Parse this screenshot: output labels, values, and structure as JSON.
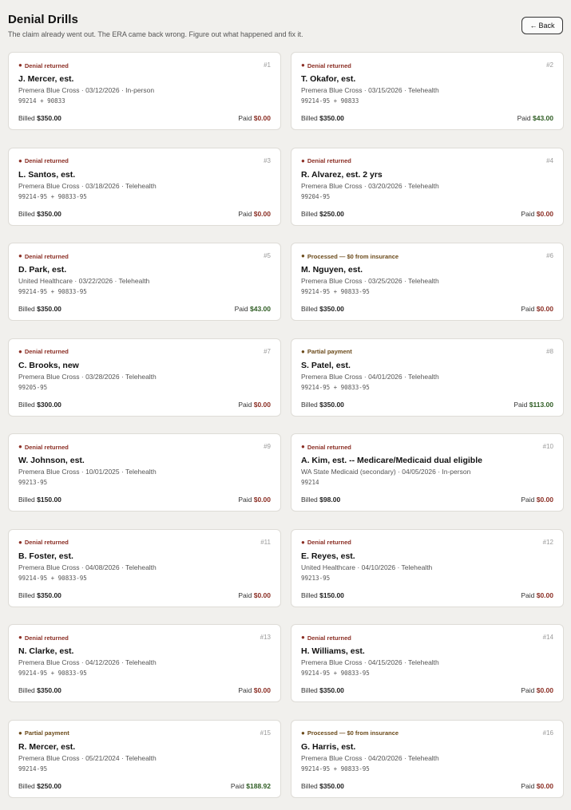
{
  "header": {
    "title": "Denial Drills",
    "subtitle": "The claim already went out. The ERA came back wrong. Figure out what happened and fix it.",
    "back_label": "Back",
    "back_arrow": "←"
  },
  "labels": {
    "billed": "Billed",
    "paid": "Paid"
  },
  "colors": {
    "denied": "#8b2e24",
    "paid_positive": "#2f5d24",
    "background": "#f1f0ed"
  },
  "cards": [
    {
      "status": "Denial returned",
      "status_type": "denied",
      "num": "#1",
      "name": "J. Mercer, est.",
      "meta": "Premera Blue Cross · 03/12/2026 · In-person",
      "codes": "99214 + 90833",
      "billed": "$350.00",
      "paid": "$0.00",
      "paid_positive": false
    },
    {
      "status": "Denial returned",
      "status_type": "denied",
      "num": "#2",
      "name": "T. Okafor, est.",
      "meta": "Premera Blue Cross · 03/15/2026 · Telehealth",
      "codes": "99214-95 + 90833",
      "billed": "$350.00",
      "paid": "$43.00",
      "paid_positive": true
    },
    {
      "status": "Denial returned",
      "status_type": "denied",
      "num": "#3",
      "name": "L. Santos, est.",
      "meta": "Premera Blue Cross · 03/18/2026 · Telehealth",
      "codes": "99214-95 + 90833-95",
      "billed": "$350.00",
      "paid": "$0.00",
      "paid_positive": false
    },
    {
      "status": "Denial returned",
      "status_type": "denied",
      "num": "#4",
      "name": "R. Alvarez, est. 2 yrs",
      "meta": "Premera Blue Cross · 03/20/2026 · Telehealth",
      "codes": "99204-95",
      "billed": "$250.00",
      "paid": "$0.00",
      "paid_positive": false
    },
    {
      "status": "Denial returned",
      "status_type": "denied",
      "num": "#5",
      "name": "D. Park, est.",
      "meta": "United Healthcare · 03/22/2026 · Telehealth",
      "codes": "99214-95 + 90833-95",
      "billed": "$350.00",
      "paid": "$43.00",
      "paid_positive": true
    },
    {
      "status": "Processed — $0 from insurance",
      "status_type": "processed",
      "num": "#6",
      "name": "M. Nguyen, est.",
      "meta": "Premera Blue Cross · 03/25/2026 · Telehealth",
      "codes": "99214-95 + 90833-95",
      "billed": "$350.00",
      "paid": "$0.00",
      "paid_positive": false
    },
    {
      "status": "Denial returned",
      "status_type": "denied",
      "num": "#7",
      "name": "C. Brooks, new",
      "meta": "Premera Blue Cross · 03/28/2026 · Telehealth",
      "codes": "99205-95",
      "billed": "$300.00",
      "paid": "$0.00",
      "paid_positive": false
    },
    {
      "status": "Partial payment",
      "status_type": "partial",
      "num": "#8",
      "name": "S. Patel, est.",
      "meta": "Premera Blue Cross · 04/01/2026 · Telehealth",
      "codes": "99214-95 + 90833-95",
      "billed": "$350.00",
      "paid": "$113.00",
      "paid_positive": true
    },
    {
      "status": "Denial returned",
      "status_type": "denied",
      "num": "#9",
      "name": "W. Johnson, est.",
      "meta": "Premera Blue Cross · 10/01/2025 · Telehealth",
      "codes": "99213-95",
      "billed": "$150.00",
      "paid": "$0.00",
      "paid_positive": false
    },
    {
      "status": "Denial returned",
      "status_type": "denied",
      "num": "#10",
      "name": "A. Kim, est. -- Medicare/Medicaid dual eligible",
      "meta": "WA State Medicaid (secondary) · 04/05/2026 · In-person",
      "codes": "99214",
      "billed": "$98.00",
      "paid": "$0.00",
      "paid_positive": false
    },
    {
      "status": "Denial returned",
      "status_type": "denied",
      "num": "#11",
      "name": "B. Foster, est.",
      "meta": "Premera Blue Cross · 04/08/2026 · Telehealth",
      "codes": "99214-95 + 90833-95",
      "billed": "$350.00",
      "paid": "$0.00",
      "paid_positive": false
    },
    {
      "status": "Denial returned",
      "status_type": "denied",
      "num": "#12",
      "name": "E. Reyes, est.",
      "meta": "United Healthcare · 04/10/2026 · Telehealth",
      "codes": "99213-95",
      "billed": "$150.00",
      "paid": "$0.00",
      "paid_positive": false
    },
    {
      "status": "Denial returned",
      "status_type": "denied",
      "num": "#13",
      "name": "N. Clarke, est.",
      "meta": "Premera Blue Cross · 04/12/2026 · Telehealth",
      "codes": "99214-95 + 90833-95",
      "billed": "$350.00",
      "paid": "$0.00",
      "paid_positive": false
    },
    {
      "status": "Denial returned",
      "status_type": "denied",
      "num": "#14",
      "name": "H. Williams, est.",
      "meta": "Premera Blue Cross · 04/15/2026 · Telehealth",
      "codes": "99214-95 + 90833-95",
      "billed": "$350.00",
      "paid": "$0.00",
      "paid_positive": false
    },
    {
      "status": "Partial payment",
      "status_type": "partial",
      "num": "#15",
      "name": "R. Mercer, est.",
      "meta": "Premera Blue Cross · 05/21/2024 · Telehealth",
      "codes": "99214-95",
      "billed": "$250.00",
      "paid": "$188.92",
      "paid_positive": true
    },
    {
      "status": "Processed — $0 from insurance",
      "status_type": "processed",
      "num": "#16",
      "name": "G. Harris, est.",
      "meta": "Premera Blue Cross · 04/20/2026 · Telehealth",
      "codes": "99214-95 + 90833-95",
      "billed": "$350.00",
      "paid": "$0.00",
      "paid_positive": false
    }
  ]
}
